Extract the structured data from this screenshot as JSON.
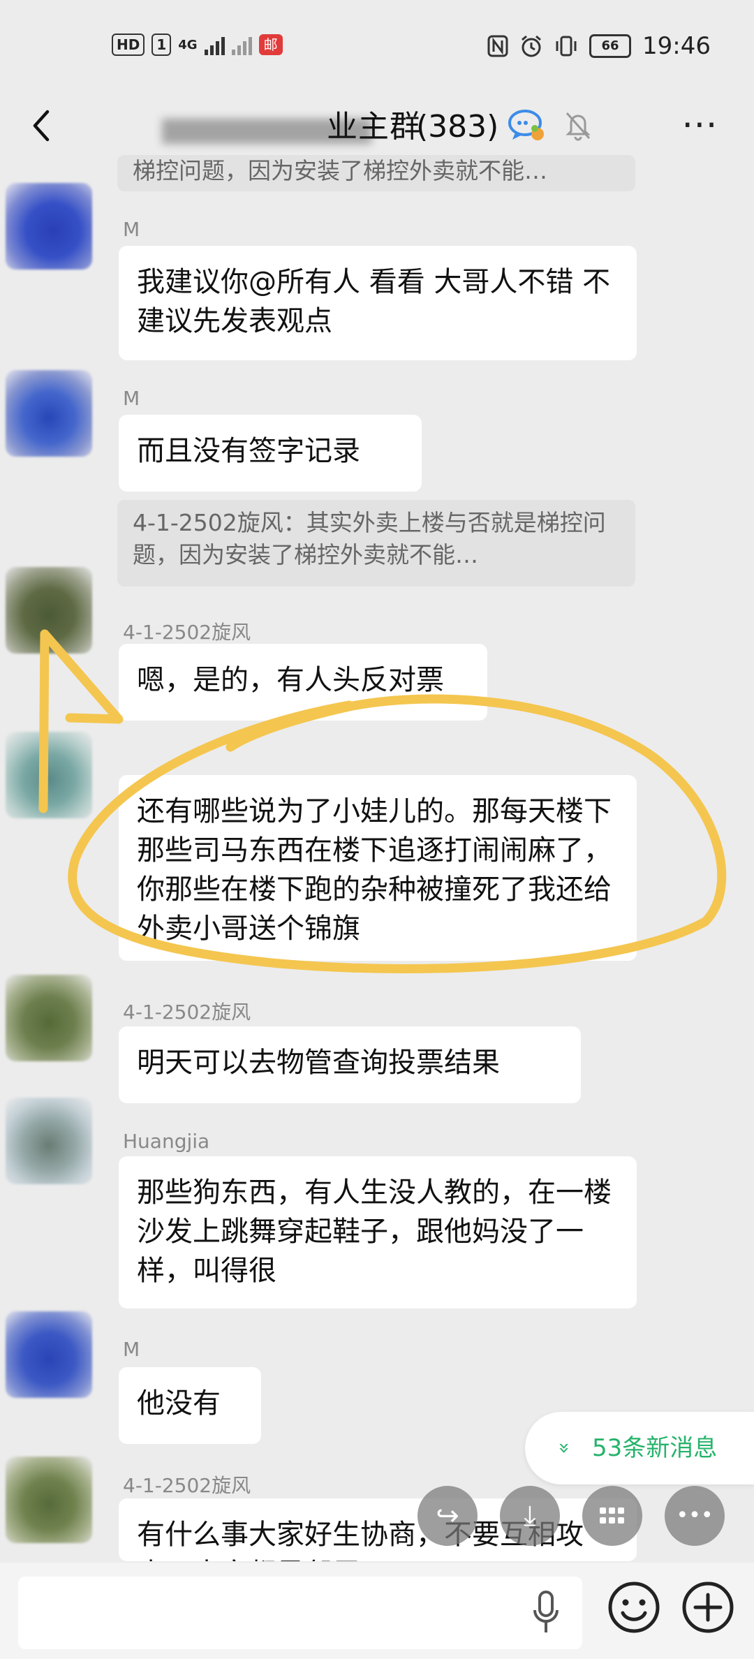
{
  "status_bar": {
    "hd": "HD",
    "sim": "1",
    "network": "4G",
    "app_badge": "邮",
    "battery": "66",
    "time": "19:46"
  },
  "header": {
    "back_icon": "chevron-left-icon",
    "title": "业主群",
    "member_count": "(383)",
    "more_icon": "more-icon"
  },
  "messages": [
    {
      "kind": "quote",
      "text": "梯控问题，因为安装了梯控外卖就不能…"
    },
    {
      "kind": "message",
      "sender": "M",
      "text": "我建议你@所有人 看看 大哥人不错 不建议先发表观点"
    },
    {
      "kind": "message",
      "sender": "M",
      "text": "而且没有签字记录"
    },
    {
      "kind": "quote",
      "text": "4-1-2502旋风：其实外卖上楼与否就是梯控问题，因为安装了梯控外卖就不能…"
    },
    {
      "kind": "message",
      "sender": "4-1-2502旋风",
      "text": "嗯，是的，有人头反对票"
    },
    {
      "kind": "message",
      "sender": "",
      "text": "还有哪些说为了小娃儿的。那每天楼下那些司马东西在楼下追逐打闹闹麻了，你那些在楼下跑的杂种被撞死了我还给外卖小哥送个锦旗"
    },
    {
      "kind": "message",
      "sender": "4-1-2502旋风",
      "text": "明天可以去物管查询投票结果"
    },
    {
      "kind": "message",
      "sender": "Huangjia",
      "text": "那些狗东西，有人生没人教的，在一楼沙发上跳舞穿起鞋子，跟他妈没了一样，叫得很"
    },
    {
      "kind": "message",
      "sender": "M",
      "text": "他没有"
    },
    {
      "kind": "message",
      "sender": "4-1-2502旋风",
      "text": "有什么事大家好生协商，不要互相攻击，大家都是邻居"
    }
  ],
  "new_messages": {
    "arrow": "»",
    "label": "53条新消息"
  },
  "fab_icons": [
    "share-icon",
    "download-icon",
    "grid-icon",
    "more-icon"
  ],
  "fab_glyphs": [
    "↪",
    "⤓",
    "⋯",
    "•••"
  ],
  "input_bar": {
    "mic_icon": "microphone-icon",
    "emoji_icon": "emoji-icon",
    "plus_icon": "plus-icon"
  },
  "colors": {
    "accent_green": "#26b36b",
    "highlight_yellow": "#f4c64f"
  }
}
